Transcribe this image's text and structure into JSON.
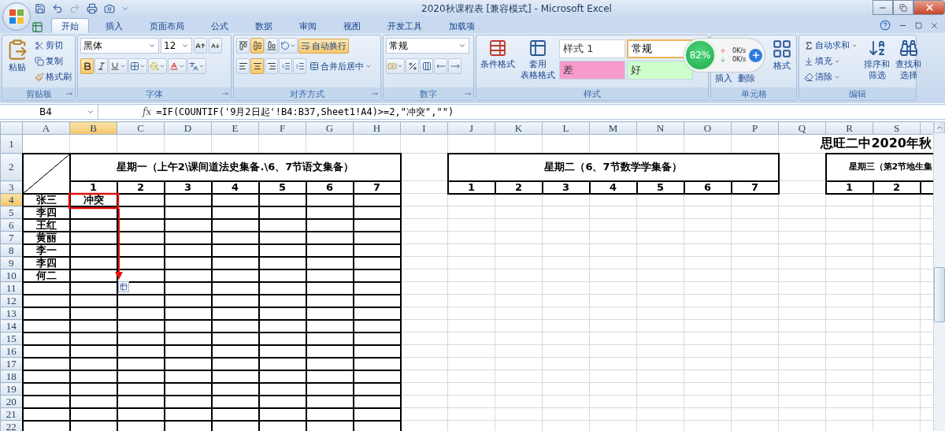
{
  "window": {
    "title": "2020秋课程表   [兼容模式] - Microsoft Excel"
  },
  "tabs": [
    {
      "label": "开始",
      "selected": true
    },
    {
      "label": "插入",
      "selected": false
    },
    {
      "label": "页面布局",
      "selected": false
    },
    {
      "label": "公式",
      "selected": false
    },
    {
      "label": "数据",
      "selected": false
    },
    {
      "label": "审阅",
      "selected": false
    },
    {
      "label": "视图",
      "selected": false
    },
    {
      "label": "开发工具",
      "selected": false
    },
    {
      "label": "加载项",
      "selected": false
    }
  ],
  "ribbon": {
    "clipboard": {
      "label": "剪贴板",
      "paste": "粘贴",
      "cut": "剪切",
      "copy": "复制",
      "format_painter": "格式刷"
    },
    "font": {
      "label": "字体",
      "font_name": "黑体",
      "font_size": "12",
      "bold": true,
      "italic": false,
      "underline": false
    },
    "alignment": {
      "label": "对齐方式",
      "vertical": [
        {
          "selected": false
        },
        {
          "selected": true
        },
        {
          "selected": false
        }
      ],
      "horizontal": [
        {
          "selected": false
        },
        {
          "selected": true
        },
        {
          "selected": false
        }
      ],
      "wrap_text": {
        "label": "自动换行",
        "on": true
      },
      "merge_center": "合并后居中"
    },
    "number": {
      "label": "数字",
      "format": "常规"
    },
    "styles": {
      "label": "样式",
      "conditional_format": [
        "条件格式"
      ],
      "format_as_table": [
        "套用",
        "表格格式"
      ],
      "cell_styles": [
        {
          "label": "样式 1",
          "color": "#ffffff",
          "selected": false
        },
        {
          "label": "常规",
          "color": "#ffffff",
          "selected": true
        },
        {
          "label": "差",
          "color": "#f79bcd",
          "selected": false
        },
        {
          "label": "好",
          "color": "#ccffcc",
          "selected": false
        }
      ]
    },
    "cells": {
      "label": "单元格",
      "buttons": [
        "插入",
        "删除",
        "格式"
      ]
    },
    "editing": {
      "label": "编辑",
      "autosum": "自动求和",
      "fill": "填充",
      "clear": "清除",
      "sort_filter": [
        "排序和",
        "筛选"
      ],
      "find_select": [
        "查找和",
        "选择"
      ]
    }
  },
  "speed_widget": {
    "percent": "82%",
    "upload": "0K/s",
    "download": "0K/s"
  },
  "formula_bar": {
    "name_box": "B4",
    "function_label": "fx",
    "formula": "=IF(COUNTIF('9月2日起'!B4:B37,Sheet1!A4)>=2,\"冲突\",\"\")"
  },
  "sheet": {
    "columns": [
      {
        "label": "A",
        "selected": false
      },
      {
        "label": "B",
        "selected": true
      },
      {
        "label": "C",
        "selected": false
      },
      {
        "label": "D",
        "selected": false
      },
      {
        "label": "E",
        "selected": false
      },
      {
        "label": "F",
        "selected": false
      },
      {
        "label": "G",
        "selected": false
      },
      {
        "label": "H",
        "selected": false
      },
      {
        "label": "I",
        "selected": false
      },
      {
        "label": "J",
        "selected": false
      },
      {
        "label": "K",
        "selected": false
      },
      {
        "label": "L",
        "selected": false
      },
      {
        "label": "M",
        "selected": false
      },
      {
        "label": "N",
        "selected": false
      },
      {
        "label": "O",
        "selected": false
      },
      {
        "label": "P",
        "selected": false
      },
      {
        "label": "Q",
        "selected": false
      },
      {
        "label": "R",
        "selected": false
      },
      {
        "label": "S",
        "selected": false
      }
    ],
    "rows": [
      {
        "label": "1",
        "selected": false
      },
      {
        "label": "2",
        "selected": false
      },
      {
        "label": "3",
        "selected": false
      },
      {
        "label": "4",
        "selected": true
      },
      {
        "label": "5",
        "selected": false
      },
      {
        "label": "6",
        "selected": false
      },
      {
        "label": "7",
        "selected": false
      },
      {
        "label": "8",
        "selected": false
      },
      {
        "label": "9",
        "selected": false
      },
      {
        "label": "10",
        "selected": false
      },
      {
        "label": "11",
        "selected": false
      },
      {
        "label": "12",
        "selected": false
      },
      {
        "label": "13",
        "selected": false
      },
      {
        "label": "14",
        "selected": false
      },
      {
        "label": "15",
        "selected": false
      },
      {
        "label": "16",
        "selected": false
      },
      {
        "label": "17",
        "selected": false
      },
      {
        "label": "18",
        "selected": false
      },
      {
        "label": "19",
        "selected": false
      },
      {
        "label": "20",
        "selected": false
      },
      {
        "label": "21",
        "selected": false
      },
      {
        "label": "22",
        "selected": false
      }
    ],
    "title": "思旺二中2020年秋",
    "days": [
      {
        "header": "星期一（上午2\\课间道法史集备.\\6、7节语文集备）",
        "periods": [
          "1",
          "2",
          "3",
          "4",
          "5",
          "6",
          "7"
        ]
      },
      {
        "header": "星期二（6、7节数学学集备）",
        "periods": [
          "1",
          "2",
          "3",
          "4",
          "5",
          "6",
          "7"
        ]
      },
      {
        "header": "星期三（第2节地生集",
        "periods": [
          "1",
          "2"
        ]
      }
    ],
    "students": [
      {
        "name": "张三",
        "period_1": "冲突"
      },
      {
        "name": "李四"
      },
      {
        "name": "王红"
      },
      {
        "name": "黄丽"
      },
      {
        "name": "李一"
      },
      {
        "name": "李四"
      },
      {
        "name": "何二"
      }
    ]
  }
}
